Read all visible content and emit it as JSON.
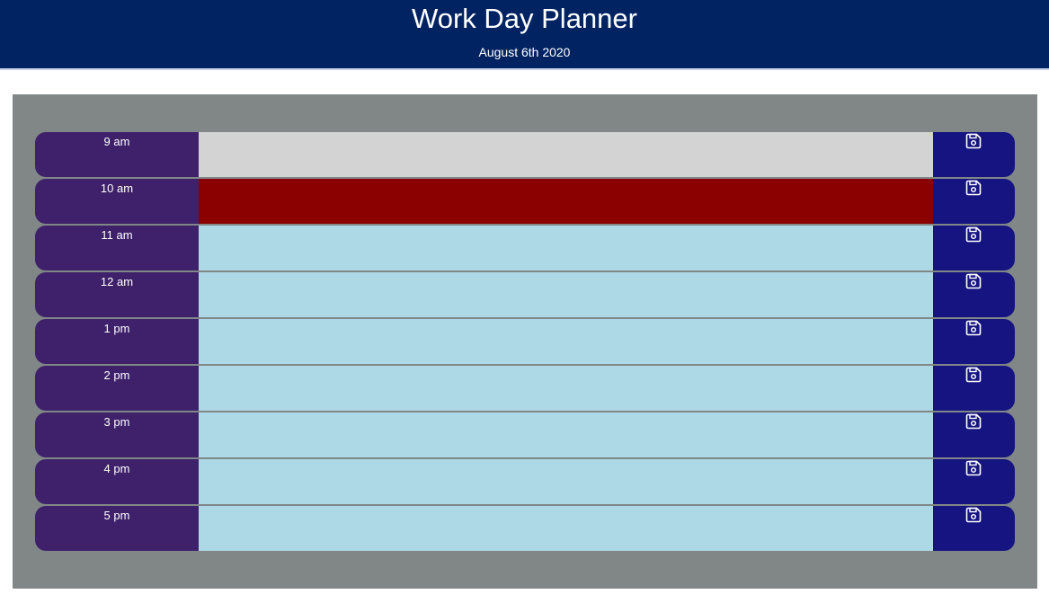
{
  "header": {
    "title": "Work Day Planner",
    "date": "August 6th 2020"
  },
  "colors": {
    "header_bg": "#022362",
    "container_bg": "#818787",
    "hour_bg": "#3e216a",
    "save_bg": "#151480",
    "past": "#d3d3d3",
    "present": "#8b0000",
    "future": "#add8e6"
  },
  "rows": [
    {
      "hour": "9 am",
      "state": "past",
      "text": "",
      "icon": "save-icon"
    },
    {
      "hour": "10 am",
      "state": "present",
      "text": "",
      "icon": "save-icon"
    },
    {
      "hour": "11 am",
      "state": "future",
      "text": "",
      "icon": "save-icon"
    },
    {
      "hour": "12 am",
      "state": "future",
      "text": "",
      "icon": "save-icon"
    },
    {
      "hour": "1 pm",
      "state": "future",
      "text": "",
      "icon": "save-icon"
    },
    {
      "hour": "2 pm",
      "state": "future",
      "text": "",
      "icon": "save-icon"
    },
    {
      "hour": "3 pm",
      "state": "future",
      "text": "",
      "icon": "save-icon"
    },
    {
      "hour": "4 pm",
      "state": "future",
      "text": "",
      "icon": "save-icon"
    },
    {
      "hour": "5 pm",
      "state": "future",
      "text": "",
      "icon": "save-icon"
    }
  ]
}
